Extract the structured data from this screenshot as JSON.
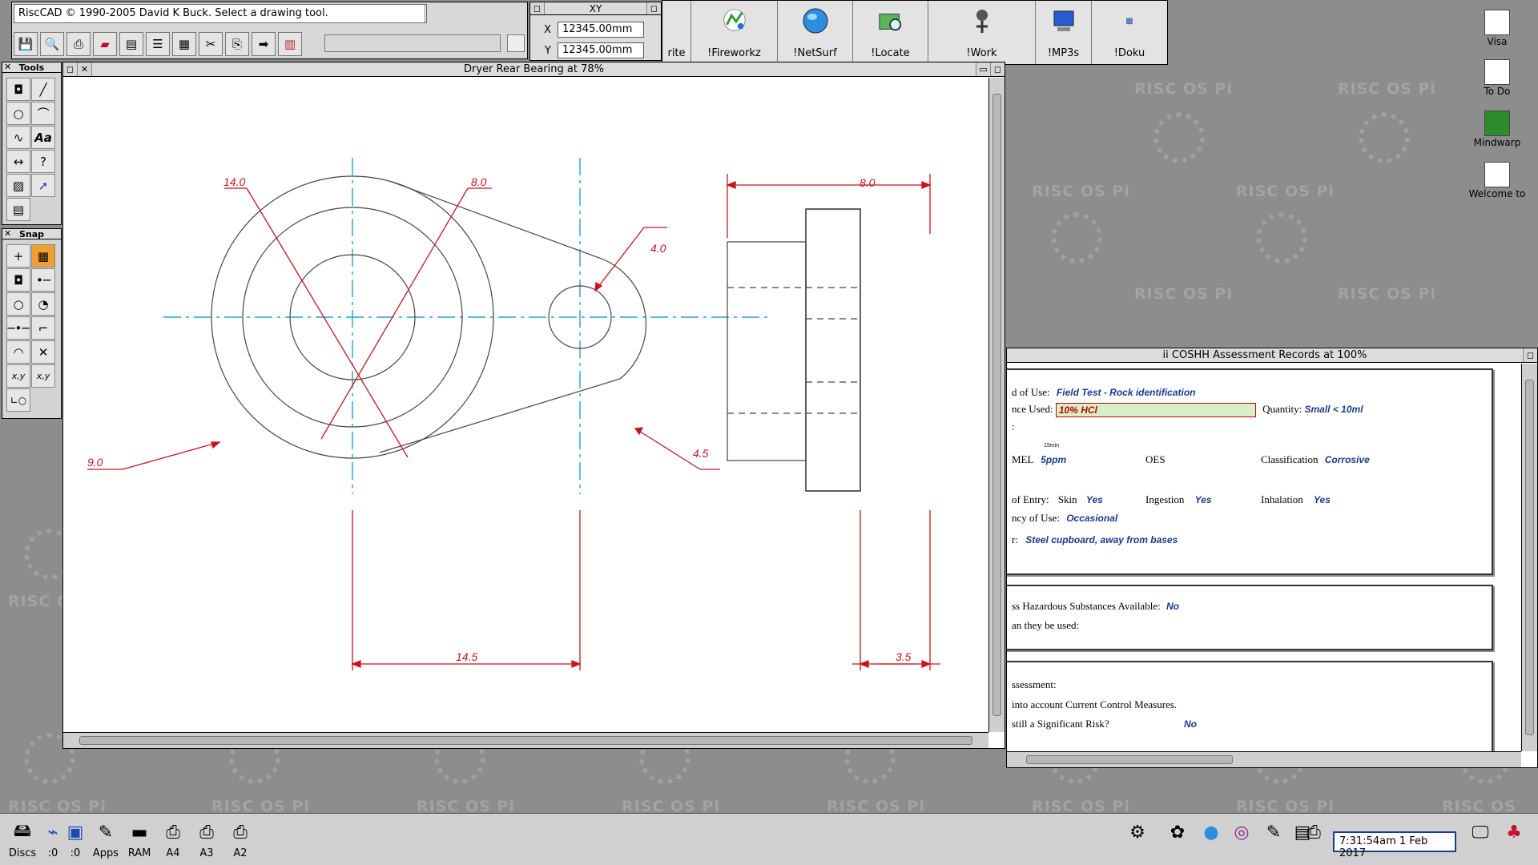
{
  "riscad": {
    "info_text": "RiscCAD © 1990-2005 David K Buck. Select a drawing tool.",
    "xy_title": "XY",
    "x_label": "X",
    "x_value": "12345.00mm",
    "y_label": "Y",
    "y_value": "12345.00mm"
  },
  "pinboard_apps": [
    {
      "label": "rite",
      "icon": "writer-icon"
    },
    {
      "label": "!Fireworkz",
      "icon": "fireworkz-icon"
    },
    {
      "label": "!NetSurf",
      "icon": "netsurf-icon"
    },
    {
      "label": "!Locate",
      "icon": "locate-icon"
    },
    {
      "label": "!Work",
      "icon": "work-icon"
    },
    {
      "label": "!MP3s",
      "icon": "mp3s-icon"
    },
    {
      "label": "!Doku",
      "icon": "doku-icon"
    }
  ],
  "tools_pane": {
    "title": "Tools"
  },
  "snap_pane": {
    "title": "Snap"
  },
  "drawing_window": {
    "title": "Dryer Rear Bearing at 78%",
    "dimensions": {
      "d1": "14.0",
      "d2": "8.0",
      "d3": "4.0",
      "d4": "9.0",
      "d5": "4.5",
      "d6": "14.5",
      "d7": "8.0",
      "d8": "3.5"
    },
    "colors": {
      "dimension": "#c8141e",
      "centerline": "#1aa8c8",
      "outline": "#444444"
    }
  },
  "coshh_window": {
    "title": "ii COSHH Assessment Records at 100%",
    "use_label": "d of Use:",
    "use_value": "Field Test - Rock identification",
    "used_label": "nce Used:",
    "used_value": "10% HCl",
    "quantity_label": "Quantity:",
    "quantity_value": "Small < 10ml",
    "colon_line": ":",
    "fifteen_min": "15min",
    "mel_label": "MEL",
    "mel_value": "5ppm",
    "oes_label": "OES",
    "class_label": "Classification",
    "class_value": "Corrosive",
    "entry_label": "of Entry:",
    "skin_label": "Skin",
    "skin_value": "Yes",
    "ingestion_label": "Ingestion",
    "ingestion_value": "Yes",
    "inhalation_label": "Inhalation",
    "inhalation_value": "Yes",
    "freq_label": "ncy of Use:",
    "freq_value": "Occasional",
    "store_label": "r:",
    "store_value": "Steel cupboard, away from bases",
    "less_label": "ss Hazardous Substances Available:",
    "less_value": "No",
    "can_label": "an they be used:",
    "assess_label": "ssessment:",
    "into_label": "into account Current Control Measures.",
    "risk_label": "still a Significant Risk?",
    "risk_value": "No"
  },
  "desktop_icons": [
    {
      "label": "Visa"
    },
    {
      "label": "To Do"
    },
    {
      "label": "Mindwarp"
    },
    {
      "label": "Welcome to"
    }
  ],
  "watermark": "RISC OS Pi",
  "iconbar": {
    "items": [
      {
        "label": "Discs"
      },
      {
        "label": ":0"
      },
      {
        "label": ":0"
      },
      {
        "label": "Apps"
      },
      {
        "label": "RAM"
      },
      {
        "label": "A4"
      },
      {
        "label": "A3"
      },
      {
        "label": "A2"
      }
    ],
    "clock": "7:31:54am 1 Feb 2017"
  }
}
